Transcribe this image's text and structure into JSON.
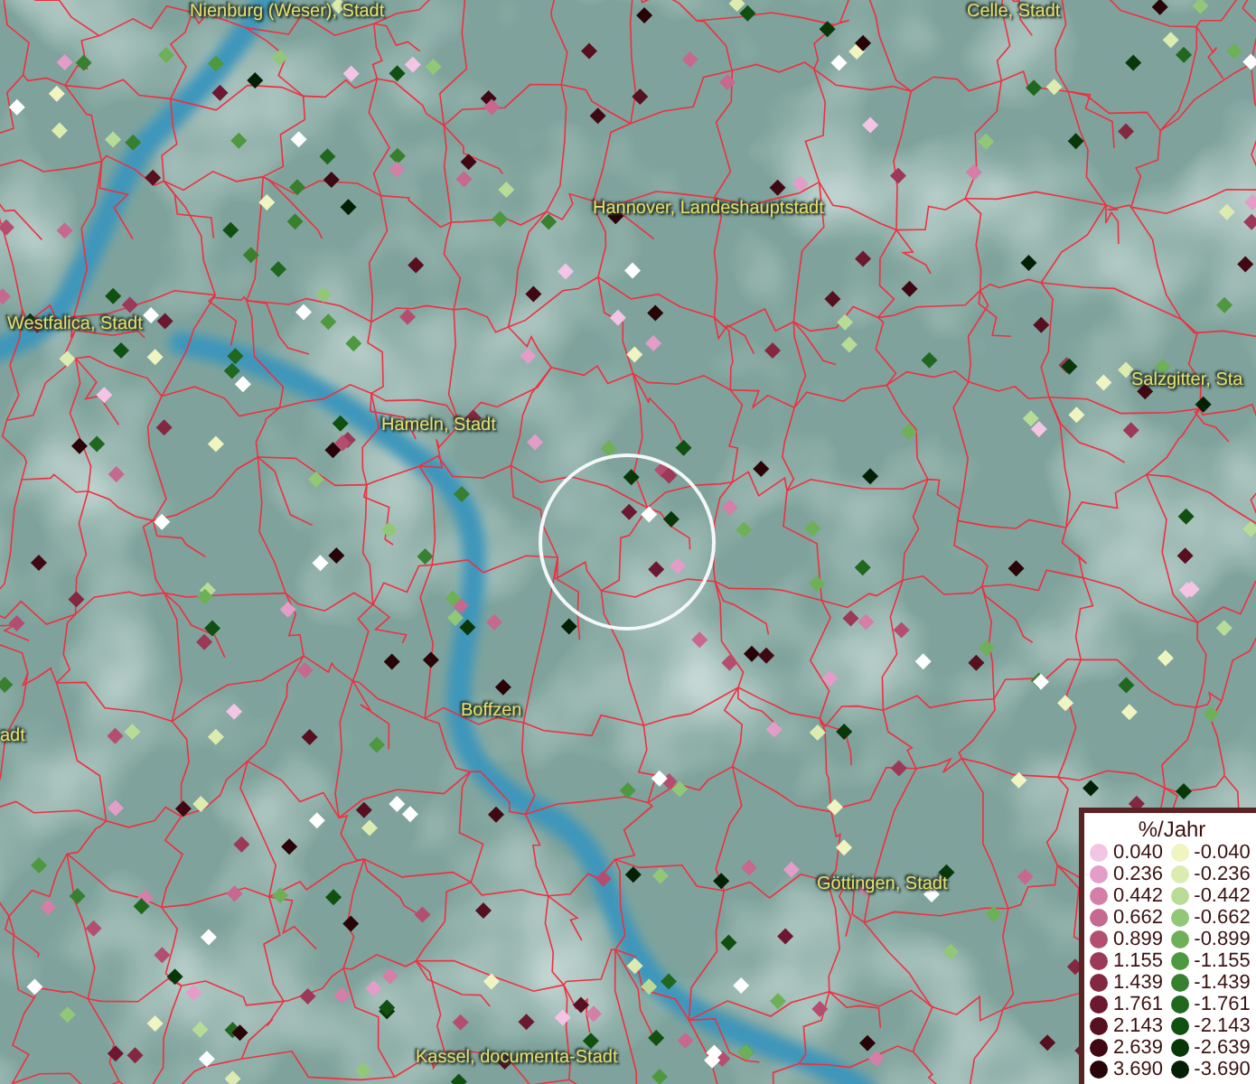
{
  "map": {
    "labels": [
      {
        "text": "Nienburg (Weser), Stadt"
      },
      {
        "text": "Celle, Stadt"
      },
      {
        "text": "Hannover, Landeshauptstadt"
      },
      {
        "text": "Westfalica, Stadt"
      },
      {
        "text": "Salzgitter, Sta"
      },
      {
        "text": "Hameln, Stadt"
      },
      {
        "text": "adt"
      },
      {
        "text": "Boffzen"
      },
      {
        "text": "Göttingen, Stadt"
      },
      {
        "text": "Kassel, documenta-Stadt"
      }
    ]
  },
  "legend": {
    "title": "%/Jahr",
    "positive": [
      {
        "value": "0.040",
        "color": "#f4c4e4"
      },
      {
        "value": "0.236",
        "color": "#e49cc8"
      },
      {
        "value": "0.442",
        "color": "#d47ea8"
      },
      {
        "value": "0.662",
        "color": "#c66890"
      },
      {
        "value": "0.899",
        "color": "#b44e70"
      },
      {
        "value": "1.155",
        "color": "#9c3858"
      },
      {
        "value": "1.439",
        "color": "#842842"
      },
      {
        "value": "1.761",
        "color": "#6c1830"
      },
      {
        "value": "2.143",
        "color": "#561020"
      },
      {
        "value": "2.639",
        "color": "#400812"
      },
      {
        "value": "3.690",
        "color": "#280408"
      }
    ],
    "negative": [
      {
        "value": "-0.040",
        "color": "#f0f4c0"
      },
      {
        "value": "-0.236",
        "color": "#dcecb0"
      },
      {
        "value": "-0.442",
        "color": "#b8dc98"
      },
      {
        "value": "-0.662",
        "color": "#90c878"
      },
      {
        "value": "-0.899",
        "color": "#6eb058"
      },
      {
        "value": "-1.155",
        "color": "#4e9840"
      },
      {
        "value": "-1.439",
        "color": "#388030"
      },
      {
        "value": "-1.761",
        "color": "#206820"
      },
      {
        "value": "-2.143",
        "color": "#105010"
      },
      {
        "value": "-2.639",
        "color": "#083808"
      },
      {
        "value": "-3.690",
        "color": "#042004"
      }
    ]
  }
}
